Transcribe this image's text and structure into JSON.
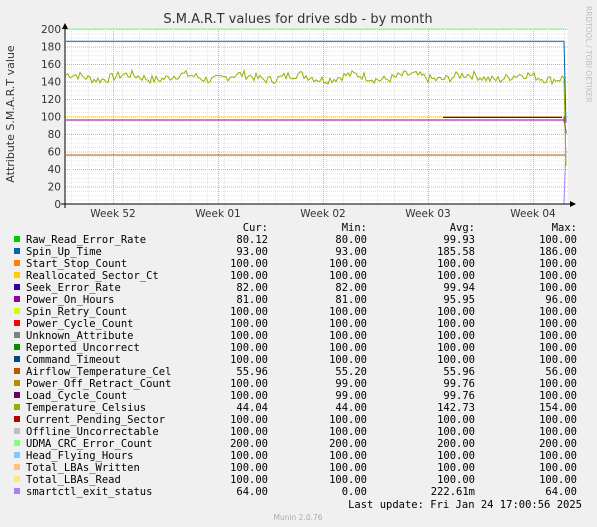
{
  "chart_data": {
    "type": "line",
    "title": "S.M.A.R.T values for drive sdb - by month",
    "ylabel": "Attribute S.M.A.R.T value",
    "side_label": "RRDTOOL / TOBI OETIKER",
    "ylim": [
      0,
      200
    ],
    "yticks": [
      0,
      20,
      40,
      60,
      80,
      100,
      120,
      140,
      160,
      180,
      200
    ],
    "xticks": [
      "Week 52",
      "Week 01",
      "Week 02",
      "Week 03",
      "Week 04"
    ],
    "grid": true,
    "columns": [
      "Cur:",
      "Min:",
      "Avg:",
      "Max:"
    ],
    "series": [
      {
        "name": "Raw_Read_Error_Rate",
        "color": "#00cc00",
        "cur": "80.12",
        "min": "80.00",
        "avg": "99.93",
        "max": "100.00",
        "level": 100
      },
      {
        "name": "Spin_Up_Time",
        "color": "#0066b3",
        "cur": "93.00",
        "min": "93.00",
        "avg": "185.58",
        "max": "186.00",
        "level": 186
      },
      {
        "name": "Start_Stop_Count",
        "color": "#ff8000",
        "cur": "100.00",
        "min": "100.00",
        "avg": "100.00",
        "max": "100.00",
        "level": 100
      },
      {
        "name": "Reallocated_Sector_Ct",
        "color": "#ffcc00",
        "cur": "100.00",
        "min": "100.00",
        "avg": "100.00",
        "max": "100.00",
        "level": 100
      },
      {
        "name": "Seek_Error_Rate",
        "color": "#330099",
        "cur": "82.00",
        "min": "82.00",
        "avg": "99.94",
        "max": "100.00",
        "level": 100
      },
      {
        "name": "Power_On_Hours",
        "color": "#990099",
        "cur": "81.00",
        "min": "81.00",
        "avg": "95.95",
        "max": "96.00",
        "level": 96
      },
      {
        "name": "Spin_Retry_Count",
        "color": "#ccff00",
        "cur": "100.00",
        "min": "100.00",
        "avg": "100.00",
        "max": "100.00",
        "level": 100
      },
      {
        "name": "Power_Cycle_Count",
        "color": "#ff0000",
        "cur": "100.00",
        "min": "100.00",
        "avg": "100.00",
        "max": "100.00",
        "level": 100
      },
      {
        "name": "Unknown_Attribute",
        "color": "#808080",
        "cur": "100.00",
        "min": "100.00",
        "avg": "100.00",
        "max": "100.00",
        "level": 100
      },
      {
        "name": "Reported_Uncorrect",
        "color": "#008f00",
        "cur": "100.00",
        "min": "100.00",
        "avg": "100.00",
        "max": "100.00",
        "level": 100
      },
      {
        "name": "Command_Timeout",
        "color": "#00487d",
        "cur": "100.00",
        "min": "100.00",
        "avg": "100.00",
        "max": "100.00",
        "level": 100
      },
      {
        "name": "Airflow_Temperature_Cel",
        "color": "#b35a00",
        "cur": "55.96",
        "min": "55.20",
        "avg": "55.96",
        "max": "56.00",
        "level": 56
      },
      {
        "name": "Power_Off_Retract_Count",
        "color": "#b38f00",
        "cur": "100.00",
        "min": "99.00",
        "avg": "99.76",
        "max": "100.00",
        "level": 100
      },
      {
        "name": "Load_Cycle_Count",
        "color": "#6b006b",
        "cur": "100.00",
        "min": "99.00",
        "avg": "99.76",
        "max": "100.00",
        "level": 100
      },
      {
        "name": "Temperature_Celsius",
        "color": "#8fb300",
        "cur": "44.04",
        "min": "44.00",
        "avg": "142.73",
        "max": "154.00",
        "level": 145
      },
      {
        "name": "Current_Pending_Sector",
        "color": "#b30000",
        "cur": "100.00",
        "min": "100.00",
        "avg": "100.00",
        "max": "100.00",
        "level": 100
      },
      {
        "name": "Offline_Uncorrectable",
        "color": "#bebebe",
        "cur": "100.00",
        "min": "100.00",
        "avg": "100.00",
        "max": "100.00",
        "level": 100
      },
      {
        "name": "UDMA_CRC_Error_Count",
        "color": "#80ff80",
        "cur": "200.00",
        "min": "200.00",
        "avg": "200.00",
        "max": "200.00",
        "level": 200
      },
      {
        "name": "Head_Flying_Hours",
        "color": "#80c9ff",
        "cur": "100.00",
        "min": "100.00",
        "avg": "100.00",
        "max": "100.00",
        "level": 100
      },
      {
        "name": "Total_LBAs_Written",
        "color": "#ffc080",
        "cur": "100.00",
        "min": "100.00",
        "avg": "100.00",
        "max": "100.00",
        "level": 100
      },
      {
        "name": "Total_LBAs_Read",
        "color": "#ffe680",
        "cur": "100.00",
        "min": "100.00",
        "avg": "100.00",
        "max": "100.00",
        "level": 100
      },
      {
        "name": "smartctl_exit_status",
        "color": "#aa80ff",
        "cur": "64.00",
        "min": "0.00",
        "avg": "222.61m",
        "max": "64.00",
        "level": 0
      }
    ]
  },
  "footer": {
    "last_update": "Last update: Fri Jan 24 17:00:56 2025",
    "munin_version": "Munin 2.0.76"
  }
}
